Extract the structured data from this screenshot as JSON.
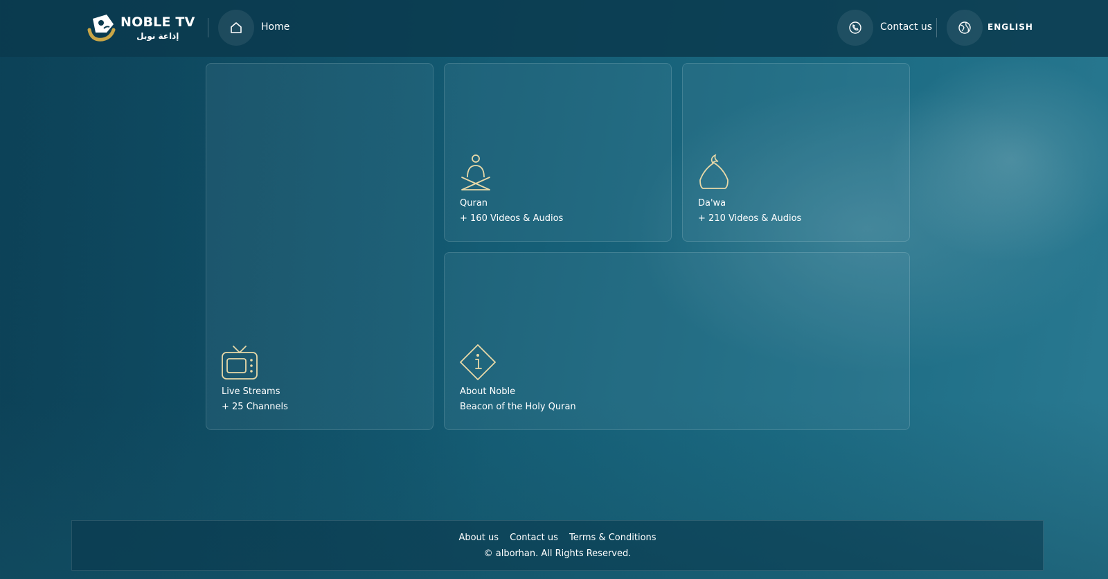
{
  "header": {
    "logo_title": "NOBLE TV",
    "logo_subtitle": "إذاعة نوبل",
    "home_label": "Home",
    "contact_label": "Contact us",
    "language_label": "ENGLISH"
  },
  "cards": {
    "live": {
      "title": "Live Streams",
      "subtitle": "+ 25 Channels",
      "icon": "tv-icon"
    },
    "quran": {
      "title": "Quran",
      "subtitle": "+ 160 Videos & Audios",
      "icon": "quran-reader-icon"
    },
    "dawa": {
      "title": "Da'wa",
      "subtitle": "+ 210 Videos & Audios",
      "icon": "mosque-dome-icon"
    },
    "about": {
      "title": "About Noble",
      "subtitle": "Beacon of the Holy Quran",
      "icon": "info-icon"
    }
  },
  "footer": {
    "links": [
      "About us",
      "Contact us",
      "Terms & Conditions"
    ],
    "copyright": "© alborhan. All Rights Reserved."
  },
  "colors": {
    "background": "#135a72",
    "header": "#0a3a4e",
    "accent_gold": "#e8d9a8",
    "logo_gold": "#c9a646"
  }
}
